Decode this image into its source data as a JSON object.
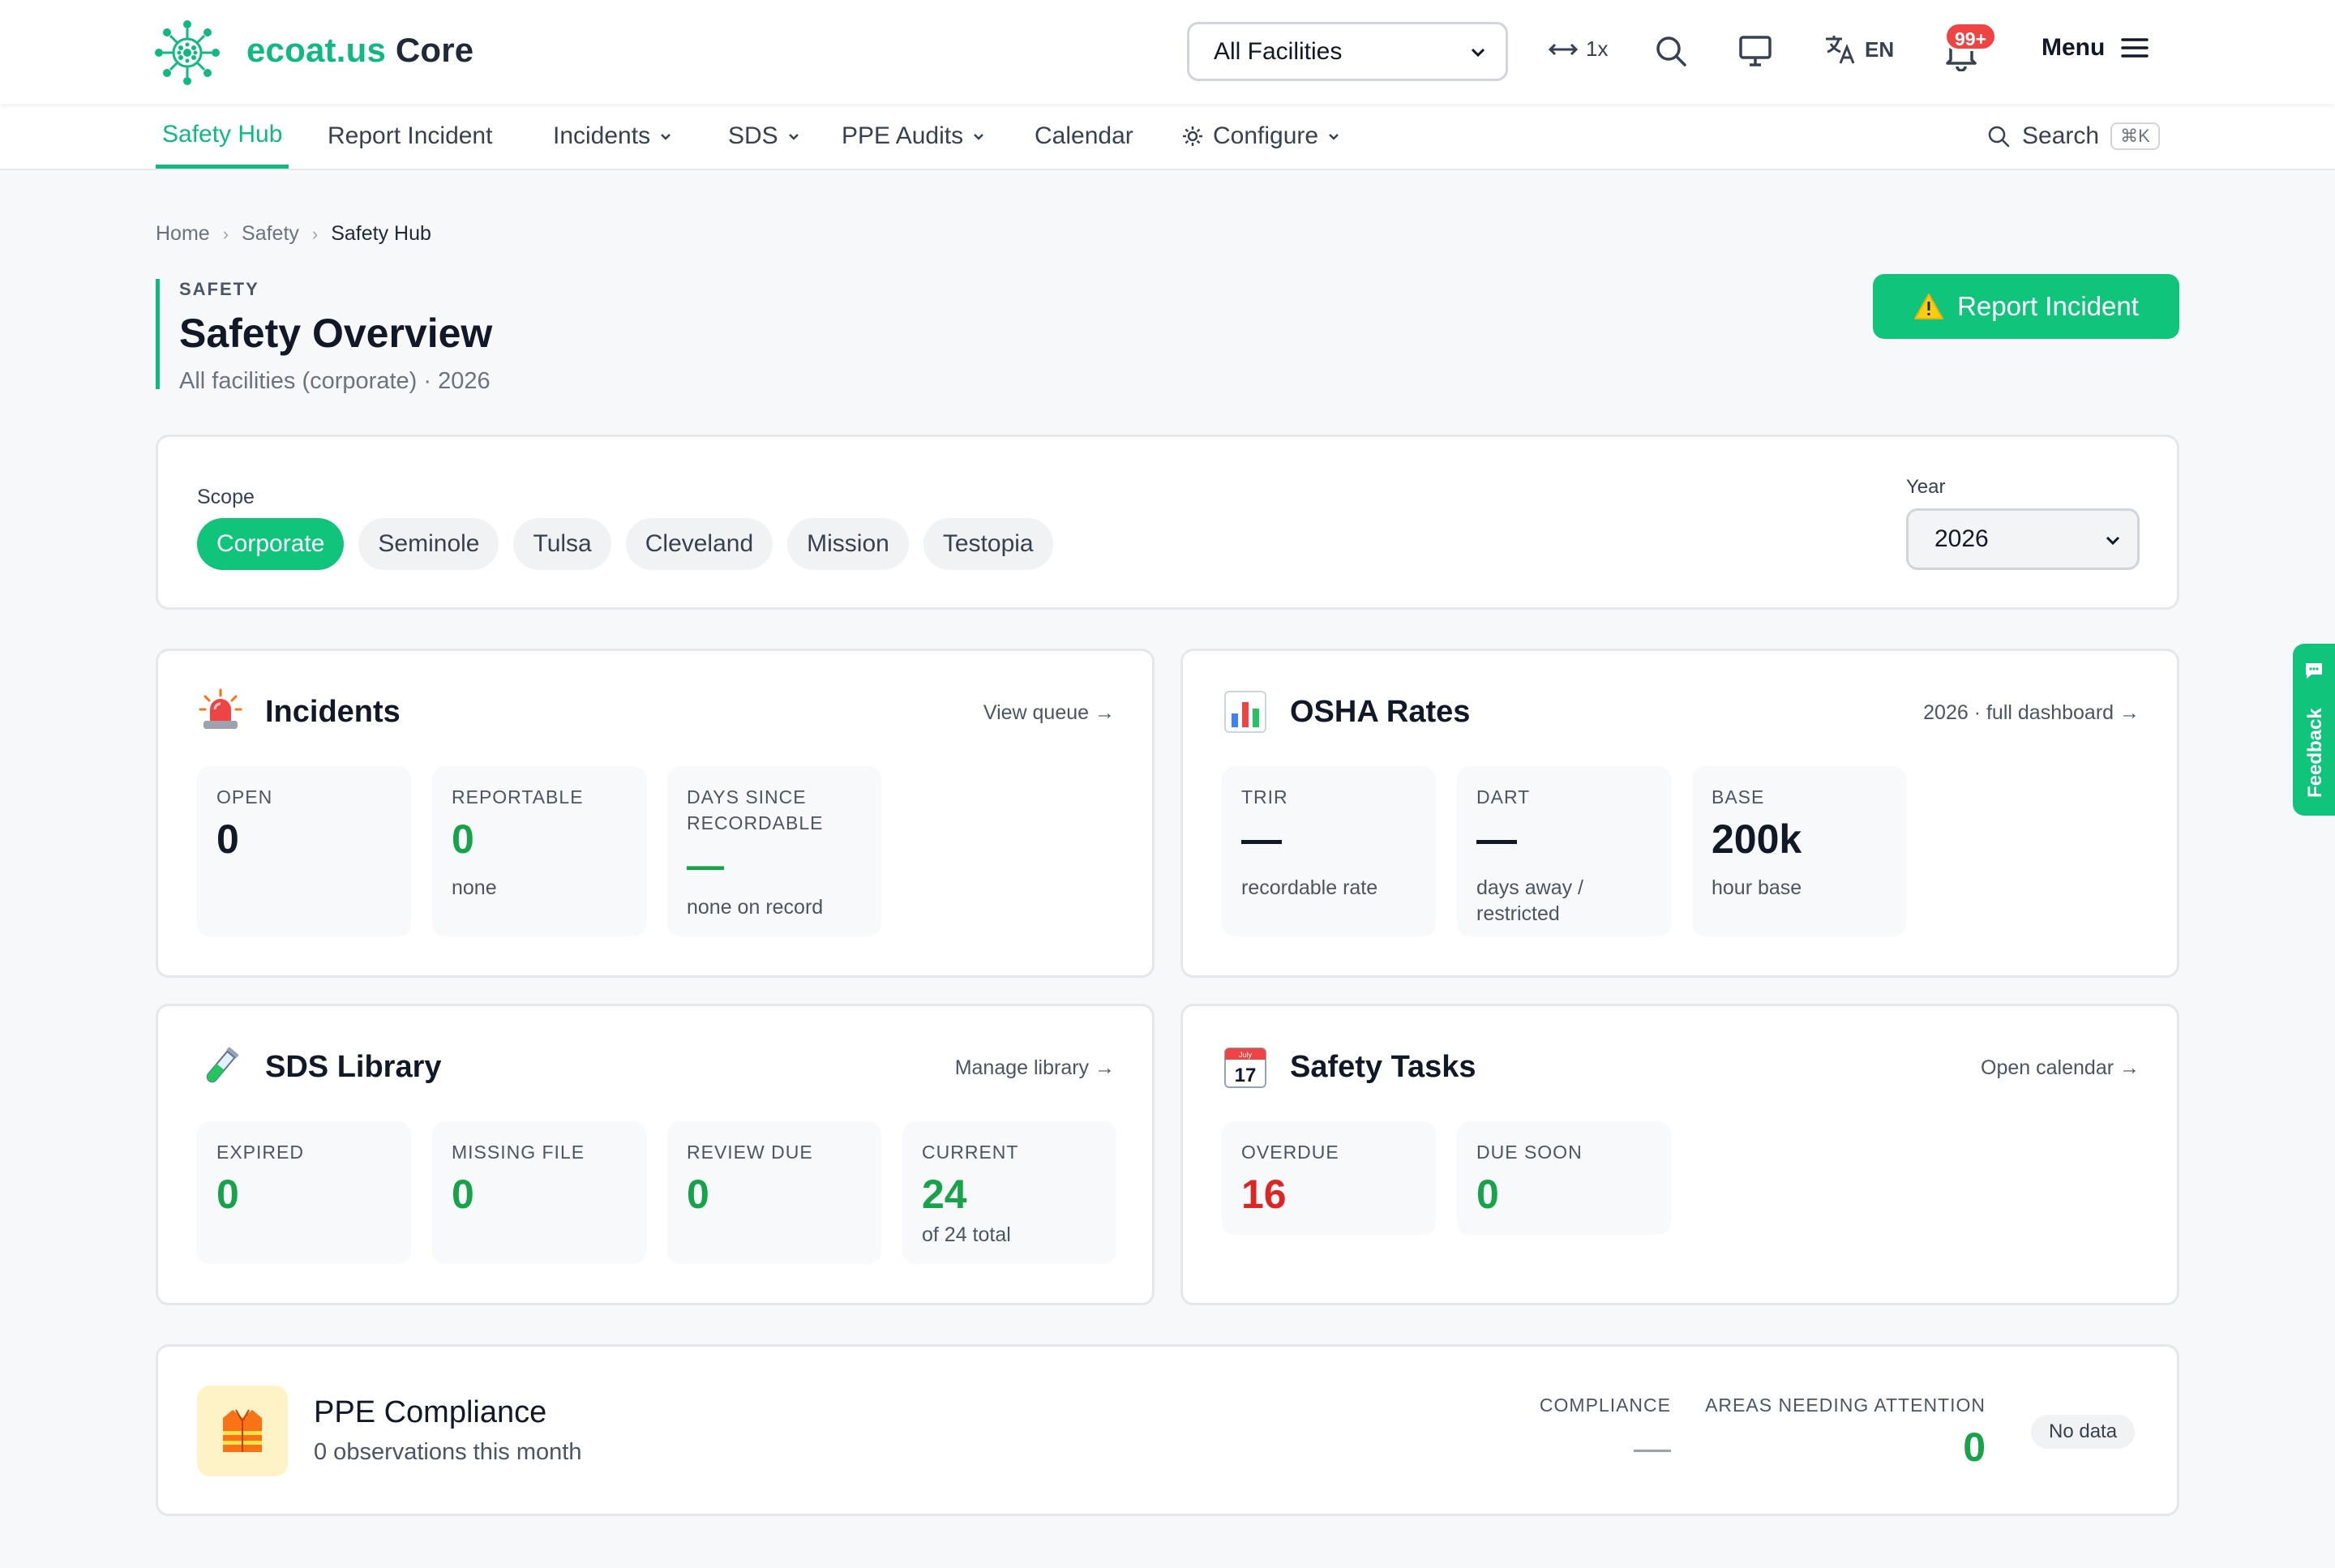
{
  "brand": {
    "name_primary": "ecoat.us",
    "name_secondary": "Core"
  },
  "topbar": {
    "facility_selected": "All Facilities",
    "zoom_label": "1x",
    "language": "EN",
    "notifications_count": "99+",
    "menu_label": "Menu",
    "icons": [
      "arrows-horizontal-icon",
      "search-icon",
      "monitor-icon",
      "translate-icon",
      "bell-icon",
      "hamburger-icon"
    ]
  },
  "nav": {
    "items": [
      {
        "label": "Safety Hub",
        "active": true,
        "dropdown": false
      },
      {
        "label": "Report Incident",
        "dropdown": false
      },
      {
        "label": "Incidents",
        "dropdown": true
      },
      {
        "label": "SDS",
        "dropdown": true
      },
      {
        "label": "PPE Audits",
        "dropdown": true
      },
      {
        "label": "Calendar",
        "dropdown": false
      },
      {
        "label": "Configure",
        "dropdown": true,
        "icon": "gear-icon"
      }
    ],
    "search_label": "Search",
    "search_shortcut": "⌘K"
  },
  "breadcrumb": [
    "Home",
    "Safety",
    "Safety Hub"
  ],
  "header": {
    "eyebrow": "SAFETY",
    "title": "Safety Overview",
    "subtitle": "All facilities (corporate) · 2026",
    "report_button": "Report Incident",
    "report_icon": "warning-icon"
  },
  "scope": {
    "label": "Scope",
    "options": [
      "Corporate",
      "Seminole",
      "Tulsa",
      "Cleveland",
      "Mission",
      "Testopia"
    ],
    "selected": "Corporate",
    "year_label": "Year",
    "year_selected": "2026"
  },
  "incidents": {
    "title": "Incidents",
    "icon": "siren-icon",
    "link": "View queue →",
    "tiles": [
      {
        "label": "OPEN",
        "value": "0",
        "sub": ""
      },
      {
        "label": "REPORTABLE",
        "value": "0",
        "sub": "none"
      },
      {
        "label": "DAYS SINCE RECORDABLE",
        "value": "—",
        "sub": "none on record"
      }
    ]
  },
  "osha": {
    "title": "OSHA Rates",
    "icon": "bar-chart-icon",
    "link": "2026 · full dashboard →",
    "tiles": [
      {
        "label": "TRIR",
        "value": "—",
        "sub": "recordable rate"
      },
      {
        "label": "DART",
        "value": "—",
        "sub": "days away / restricted"
      },
      {
        "label": "BASE",
        "value": "200k",
        "sub": "hour base"
      }
    ]
  },
  "sds": {
    "title": "SDS Library",
    "icon": "test-tube-icon",
    "link": "Manage library →",
    "tiles": [
      {
        "label": "EXPIRED",
        "value": "0",
        "sub": ""
      },
      {
        "label": "MISSING FILE",
        "value": "0",
        "sub": ""
      },
      {
        "label": "REVIEW DUE",
        "value": "0",
        "sub": ""
      },
      {
        "label": "CURRENT",
        "value": "24",
        "sub": "of 24 total"
      }
    ]
  },
  "tasks": {
    "title": "Safety Tasks",
    "icon": "calendar-icon",
    "calendar_month": "July",
    "calendar_day": "17",
    "link": "Open calendar →",
    "tiles": [
      {
        "label": "OVERDUE",
        "value": "16",
        "sub": ""
      },
      {
        "label": "DUE SOON",
        "value": "0",
        "sub": ""
      }
    ]
  },
  "ppe": {
    "title": "PPE Compliance",
    "icon": "safety-vest-icon",
    "subtitle": "0 observations this month",
    "compliance_label": "COMPLIANCE",
    "compliance_value": "—",
    "areas_label": "AREAS NEEDING ATTENTION",
    "areas_value": "0",
    "status": "No data"
  },
  "feedback": {
    "label": "Feedback",
    "icon": "chat-bubble-icon"
  },
  "colors": {
    "accent": "#10b981",
    "button_green": "#10c47c",
    "value_green": "#16a34a",
    "value_red": "#dc2626",
    "badge_red": "#ef4444"
  }
}
